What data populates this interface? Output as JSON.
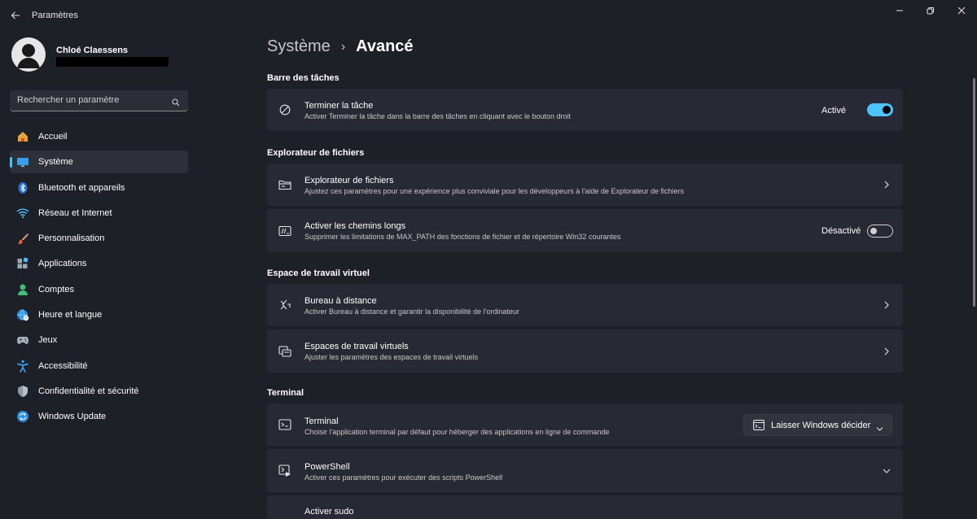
{
  "window": {
    "title": "Paramètres",
    "controls": [
      "minimize-icon",
      "restore-icon",
      "close-icon"
    ]
  },
  "profile": {
    "name": "Chloé Claessens"
  },
  "search": {
    "placeholder": "Rechercher un paramètre"
  },
  "sidebar": {
    "items": [
      {
        "label": "Accueil",
        "icon": "home-icon"
      },
      {
        "label": "Système",
        "icon": "monitor-icon",
        "active": true
      },
      {
        "label": "Bluetooth et appareils",
        "icon": "bluetooth-icon"
      },
      {
        "label": "Réseau et Internet",
        "icon": "wifi-icon"
      },
      {
        "label": "Personnalisation",
        "icon": "brush-icon"
      },
      {
        "label": "Applications",
        "icon": "apps-icon"
      },
      {
        "label": "Comptes",
        "icon": "person-icon"
      },
      {
        "label": "Heure et langue",
        "icon": "globe-clock-icon"
      },
      {
        "label": "Jeux",
        "icon": "gamepad-icon"
      },
      {
        "label": "Accessibilité",
        "icon": "accessibility-icon"
      },
      {
        "label": "Confidentialité et sécurité",
        "icon": "shield-icon"
      },
      {
        "label": "Windows Update",
        "icon": "update-icon"
      }
    ]
  },
  "breadcrumb": {
    "parent": "Système",
    "separator": "›",
    "current": "Avancé"
  },
  "sections": {
    "taskbar": "Barre des tâches",
    "explorer": "Explorateur de fichiers",
    "virtual": "Espace de travail virtuel",
    "terminal": "Terminal"
  },
  "cards": {
    "end_task": {
      "title": "Terminer la tâche",
      "desc": "Activer Terminer la tâche dans la barre des tâches en cliquant avec le bouton droit",
      "state": "Activé",
      "on": true
    },
    "file_explorer": {
      "title": "Explorateur de fichiers",
      "desc": "Ajustez ces paramètres pour une expérience plus conviviale pour les développeurs à l'aide de Explorateur de fichiers"
    },
    "long_paths": {
      "title": "Activer les chemins longs",
      "desc": "Supprimer les limitations de MAX_PATH des fonctions de fichier et de répertoire Win32 courantes",
      "state": "Désactivé",
      "on": false
    },
    "remote_desktop": {
      "title": "Bureau à distance",
      "desc": "Activer Bureau à distance et garantir la disponibilité de l'ordinateur"
    },
    "virtual_workspaces": {
      "title": "Espaces de travail virtuels",
      "desc": "Ajuster les paramètres des espaces de travail virtuels"
    },
    "terminal": {
      "title": "Terminal",
      "desc": "Choisir l'application terminal par défaut pour héberger des applications en ligne de commande",
      "selected": "Laisser Windows décider"
    },
    "powershell": {
      "title": "PowerShell",
      "desc": "Activer ces paramètres pour exécuter des scripts PowerShell"
    },
    "sudo": {
      "title": "Activer sudo"
    }
  },
  "colors": {
    "accent": "#4cc2ff",
    "background": "#1e2028",
    "card": "#272934"
  }
}
